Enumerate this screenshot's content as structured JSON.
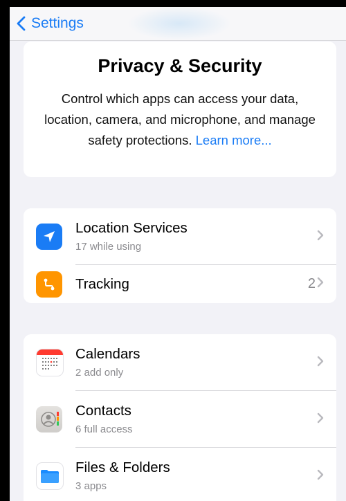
{
  "nav": {
    "back_label": "Settings"
  },
  "header": {
    "title": "Privacy & Security",
    "description": "Control which apps can access your data, location, camera, and microphone, and manage safety protections.",
    "learn_more": "Learn more..."
  },
  "group1": {
    "items": [
      {
        "title": "Location Services",
        "subtitle": "17 while using",
        "icon": "location-arrow-icon",
        "icon_color": "#1a7cf5"
      },
      {
        "title": "Tracking",
        "value": "2",
        "icon": "tracking-icon",
        "icon_color": "#ff9500"
      }
    ]
  },
  "group2": {
    "items": [
      {
        "title": "Calendars",
        "subtitle": "2 add only",
        "icon": "calendar-icon"
      },
      {
        "title": "Contacts",
        "subtitle": "6 full access",
        "icon": "contacts-icon"
      },
      {
        "title": "Files & Folders",
        "subtitle": "3 apps",
        "icon": "folder-icon",
        "icon_color": "#1a8cff"
      }
    ]
  },
  "colors": {
    "accent": "#1a7cf5",
    "background": "#f2f2f7",
    "secondary_text": "#8a8a8e"
  }
}
